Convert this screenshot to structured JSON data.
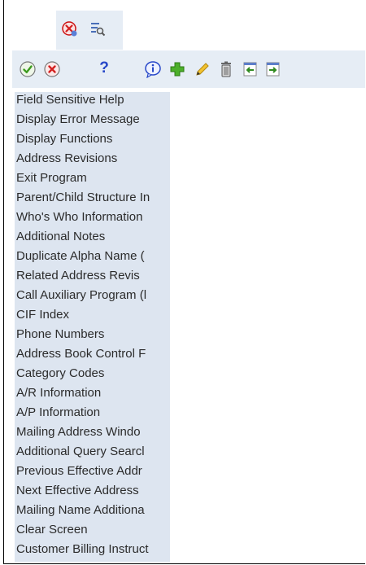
{
  "top_toolbar": {
    "icons": [
      "cancel-close-icon",
      "search-list-icon"
    ]
  },
  "toolbar": {
    "icons": [
      "ok-check-icon",
      "cancel-x-icon",
      "help-question-icon",
      "info-icon",
      "add-plus-icon",
      "edit-pencil-icon",
      "delete-trash-icon",
      "import-icon",
      "export-icon"
    ],
    "help_label": "?"
  },
  "menu": {
    "items": [
      {
        "label": "Field Sensitive Help"
      },
      {
        "label": "Display Error Message"
      },
      {
        "label": "Display Functions"
      },
      {
        "label": "Address Revisions"
      },
      {
        "label": "Exit Program"
      },
      {
        "label": "Parent/Child Structure In"
      },
      {
        "label": "Who's Who Information"
      },
      {
        "label": "Additional Notes"
      },
      {
        "label": "Duplicate Alpha Name ("
      },
      {
        "label": "Related Address Revis"
      },
      {
        "label": "Call Auxiliary Program (l"
      },
      {
        "label": "CIF Index"
      },
      {
        "label": "Phone Numbers"
      },
      {
        "label": "Address Book Control F"
      },
      {
        "label": "Category Codes"
      },
      {
        "label": "A/R Information"
      },
      {
        "label": "A/P Information"
      },
      {
        "label": "Mailing Address Windo"
      },
      {
        "label": "Additional Query Searcl"
      },
      {
        "label": "Previous Effective Addr"
      },
      {
        "label": "Next Effective Address"
      },
      {
        "label": "Mailing Name Additiona"
      },
      {
        "label": "Clear Screen"
      },
      {
        "label": "Customer Billing Instruct"
      }
    ]
  },
  "colors": {
    "toolbar_bg": "#e6edf5",
    "menu_bg": "#dde5f0",
    "ok_green": "#3c9a1e",
    "cancel_red": "#d32020",
    "help_blue": "#2747c8"
  }
}
